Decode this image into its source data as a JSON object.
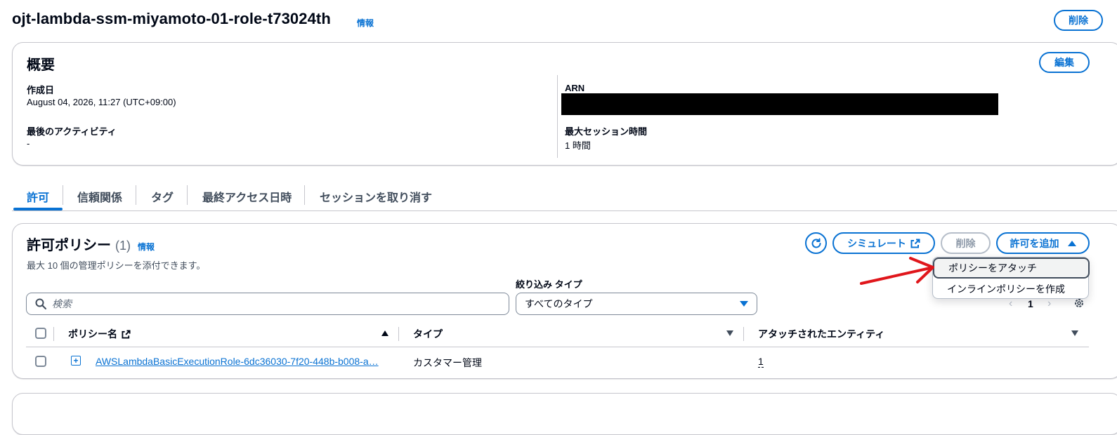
{
  "header": {
    "title": "ojt-lambda-ssm-miyamoto-01-role-t73024th",
    "info_label": "情報",
    "delete_label": "削除"
  },
  "summary": {
    "title": "概要",
    "edit_label": "編集",
    "created_label": "作成日",
    "created_value": "August 04, 2026, 11:27 (UTC+09:00)",
    "last_activity_label": "最後のアクティビティ",
    "last_activity_value": "-",
    "arn_label": "ARN",
    "max_session_label": "最大セッション時間",
    "max_session_value": "1 時間"
  },
  "tabs": [
    {
      "label": "許可"
    },
    {
      "label": "信頼関係"
    },
    {
      "label": "タグ"
    },
    {
      "label": "最終アクセス日時"
    },
    {
      "label": "セッションを取り消す"
    }
  ],
  "policies": {
    "title": "許可ポリシー",
    "count": "(1)",
    "info_label": "情報",
    "description": "最大 10 個の管理ポリシーを添付できます。",
    "simulate_label": "シミュレート",
    "delete_label": "削除",
    "add_label": "許可を追加",
    "filter_type_label": "絞り込み タイプ",
    "search_placeholder": "検索",
    "type_select_value": "すべてのタイプ",
    "page_number": "1",
    "columns": [
      "ポリシー名",
      "タイプ",
      "アタッチされたエンティティ"
    ],
    "rows": [
      {
        "name": "AWSLambdaBasicExecutionRole-6dc36030-7f20-448b-b008-a…",
        "type": "カスタマー管理",
        "entities": "1"
      }
    ]
  },
  "dropdown_menu": {
    "items": [
      "ポリシーをアタッチ",
      "インラインポリシーを作成"
    ]
  },
  "colors": {
    "accent": "#0972d3",
    "annotation_arrow": "#e0161b",
    "redaction": "#000000"
  },
  "icons": [
    "external-link-icon",
    "refresh-icon",
    "search-icon",
    "settings-icon",
    "expand-icon"
  ]
}
